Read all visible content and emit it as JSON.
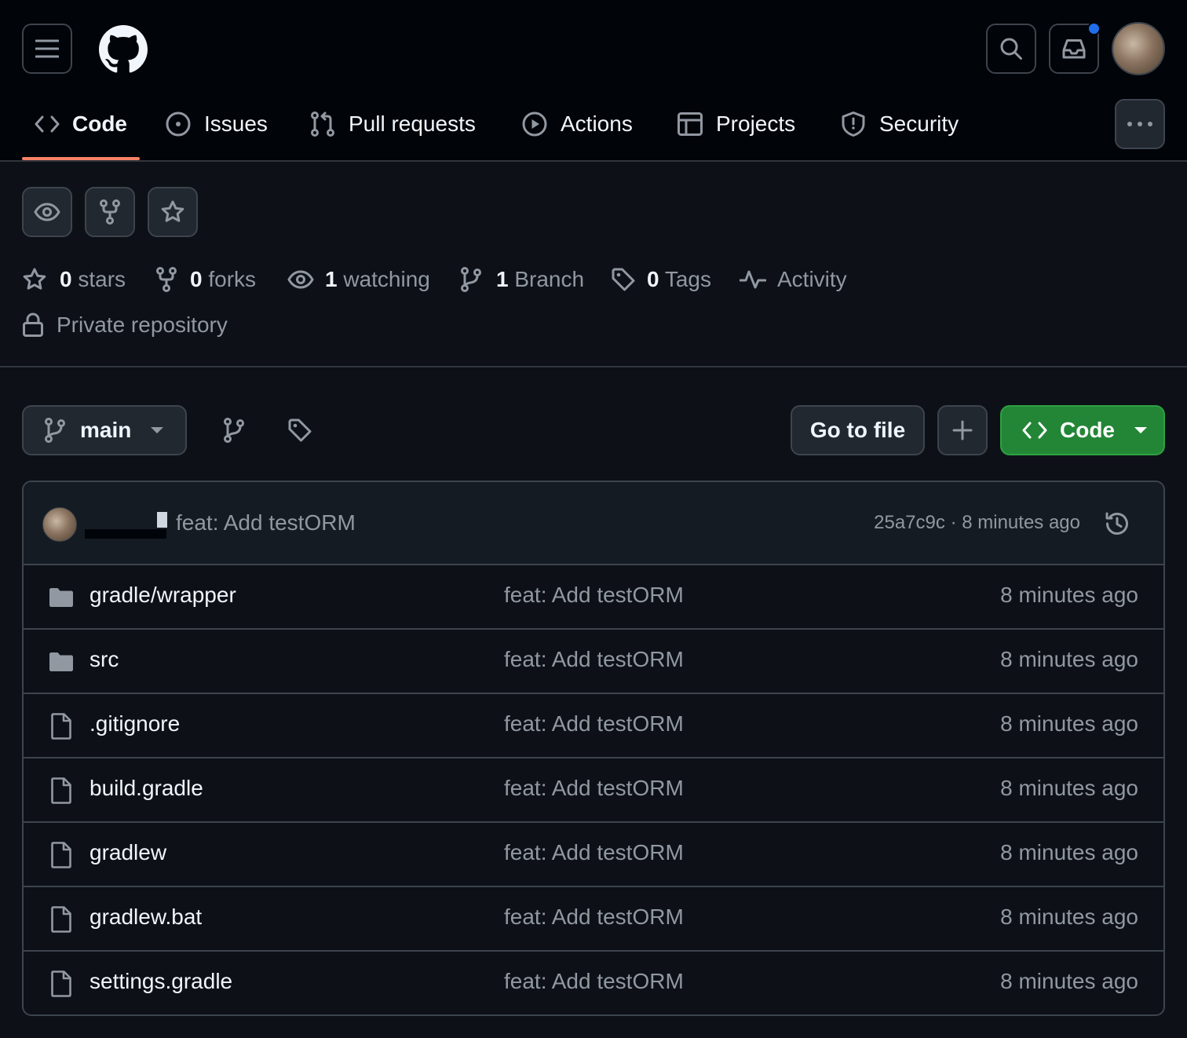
{
  "header": {
    "tabs": [
      {
        "label": "Code",
        "icon": "code-icon",
        "selected": true
      },
      {
        "label": "Issues",
        "icon": "issue-opened-icon"
      },
      {
        "label": "Pull requests",
        "icon": "git-pull-request-icon"
      },
      {
        "label": "Actions",
        "icon": "play-icon"
      },
      {
        "label": "Projects",
        "icon": "table-icon"
      },
      {
        "label": "Security",
        "icon": "shield-icon"
      }
    ]
  },
  "colors": {
    "accent_underline": "#f78166",
    "code_button": "#238636",
    "notification_dot": "#1f6feb"
  },
  "repo_meta": {
    "stars_count": "0",
    "stars_label": "stars",
    "forks_count": "0",
    "forks_label": "forks",
    "watching_count": "1",
    "watching_label": "watching",
    "branch_count": "1",
    "branch_label": "Branch",
    "tags_count": "0",
    "tags_label": "Tags",
    "activity_label": "Activity",
    "visibility": "Private repository"
  },
  "branch_bar": {
    "branch": "main",
    "go_to_file": "Go to file",
    "add_icon": "+",
    "code_label": "Code"
  },
  "latest_commit": {
    "message": "feat: Add testORM",
    "sha": "25a7c9c",
    "separator": "·",
    "time": "8 minutes ago"
  },
  "files": [
    {
      "type": "folder",
      "name": "gradle/wrapper",
      "message": "feat: Add testORM",
      "time": "8 minutes ago"
    },
    {
      "type": "folder",
      "name": "src",
      "message": "feat: Add testORM",
      "time": "8 minutes ago"
    },
    {
      "type": "file",
      "name": ".gitignore",
      "message": "feat: Add testORM",
      "time": "8 minutes ago"
    },
    {
      "type": "file",
      "name": "build.gradle",
      "message": "feat: Add testORM",
      "time": "8 minutes ago"
    },
    {
      "type": "file",
      "name": "gradlew",
      "message": "feat: Add testORM",
      "time": "8 minutes ago"
    },
    {
      "type": "file",
      "name": "gradlew.bat",
      "message": "feat: Add testORM",
      "time": "8 minutes ago"
    },
    {
      "type": "file",
      "name": "settings.gradle",
      "message": "feat: Add testORM",
      "time": "8 minutes ago"
    }
  ]
}
